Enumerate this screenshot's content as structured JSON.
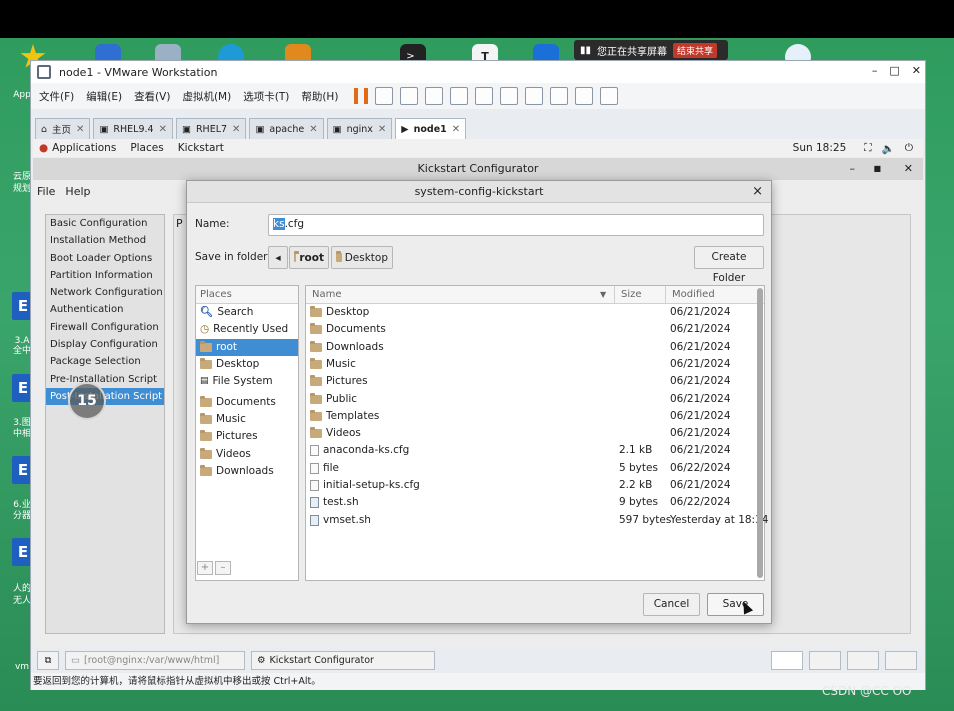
{
  "host": {
    "share_text": "您正在共享屏幕",
    "stop_share": "结束共享",
    "left_labels": [
      "App",
      "云原",
      "规划",
      "3.A",
      "全中",
      "3.图",
      "中相",
      "6.业",
      "分器",
      "人的",
      "无人",
      "vm"
    ],
    "tile_letter": "E"
  },
  "vmware": {
    "title": "node1 - VMware Workstation",
    "menu": [
      "文件(F)",
      "编辑(E)",
      "查看(V)",
      "虚拟机(M)",
      "选项卡(T)",
      "帮助(H)"
    ],
    "win_controls": [
      "–",
      "□",
      "✕"
    ],
    "tabs": [
      {
        "label": "主页",
        "active": false
      },
      {
        "label": "RHEL9.4",
        "active": false
      },
      {
        "label": "RHEL7",
        "active": false
      },
      {
        "label": "apache",
        "active": false
      },
      {
        "label": "nginx",
        "active": false
      },
      {
        "label": "node1",
        "active": true
      }
    ],
    "status_tasks": [
      "[root@nginx:/var/www/html]",
      "Kickstart Configurator"
    ],
    "hint": "要返回到您的计算机，请将鼠标指针从虚拟机中移出或按 Ctrl+Alt。",
    "watermark": "CSDN @CC OO"
  },
  "gnome": {
    "applications": "Applications",
    "places": "Places",
    "kickstart": "Kickstart",
    "clock": "Sun 18:25"
  },
  "kickstart": {
    "title": "Kickstart Configurator",
    "menu": [
      "File",
      "Help"
    ],
    "sidebar": [
      "Basic Configuration",
      "Installation Method",
      "Boot Loader Options",
      "Partition Information",
      "Network Configuration",
      "Authentication",
      "Firewall Configuration",
      "Display Configuration",
      "Package Selection",
      "Pre-Installation Script",
      "Post-Installation Script"
    ],
    "selected_index": 10,
    "main_letter": "P",
    "overlay_number": "15"
  },
  "dialog": {
    "title": "system-config-kickstart",
    "close": "×",
    "name_label": "Name:",
    "name_selected": "ks",
    "name_rest": ".cfg",
    "folder_label": "Save in folder:",
    "path": [
      "root",
      "Desktop"
    ],
    "create_folder": "Create Folder",
    "places_header": "Places",
    "places": [
      {
        "label": "Search",
        "icon": "search-icon",
        "selected": false
      },
      {
        "label": "Recently Used",
        "icon": "clock-icon",
        "selected": false
      },
      {
        "label": "root",
        "icon": "folder-icon",
        "selected": true
      },
      {
        "label": "Desktop",
        "icon": "folder-icon",
        "selected": false
      },
      {
        "label": "File System",
        "icon": "drive-icon",
        "selected": false
      },
      {
        "label": "Documents",
        "icon": "folder-icon",
        "selected": false
      },
      {
        "label": "Music",
        "icon": "folder-icon",
        "selected": false
      },
      {
        "label": "Pictures",
        "icon": "folder-icon",
        "selected": false
      },
      {
        "label": "Videos",
        "icon": "folder-icon",
        "selected": false
      },
      {
        "label": "Downloads",
        "icon": "folder-icon",
        "selected": false
      }
    ],
    "columns": {
      "name": "Name",
      "size": "Size",
      "modified": "Modified"
    },
    "files": [
      {
        "name": "Desktop",
        "size": "",
        "modified": "06/21/2024",
        "type": "folder"
      },
      {
        "name": "Documents",
        "size": "",
        "modified": "06/21/2024",
        "type": "folder"
      },
      {
        "name": "Downloads",
        "size": "",
        "modified": "06/21/2024",
        "type": "folder"
      },
      {
        "name": "Music",
        "size": "",
        "modified": "06/21/2024",
        "type": "folder"
      },
      {
        "name": "Pictures",
        "size": "",
        "modified": "06/21/2024",
        "type": "folder"
      },
      {
        "name": "Public",
        "size": "",
        "modified": "06/21/2024",
        "type": "folder"
      },
      {
        "name": "Templates",
        "size": "",
        "modified": "06/21/2024",
        "type": "folder"
      },
      {
        "name": "Videos",
        "size": "",
        "modified": "06/21/2024",
        "type": "folder"
      },
      {
        "name": "anaconda-ks.cfg",
        "size": "2.1 kB",
        "modified": "06/21/2024",
        "type": "file"
      },
      {
        "name": "file",
        "size": "5 bytes",
        "modified": "06/22/2024",
        "type": "file"
      },
      {
        "name": "initial-setup-ks.cfg",
        "size": "2.2 kB",
        "modified": "06/21/2024",
        "type": "file"
      },
      {
        "name": "test.sh",
        "size": "9 bytes",
        "modified": "06/22/2024",
        "type": "script"
      },
      {
        "name": "vmset.sh",
        "size": "597 bytes",
        "modified": "Yesterday at 18:34",
        "type": "script"
      }
    ],
    "add_btn": "+",
    "remove_btn": "–",
    "cancel": "Cancel",
    "save": "Save"
  }
}
